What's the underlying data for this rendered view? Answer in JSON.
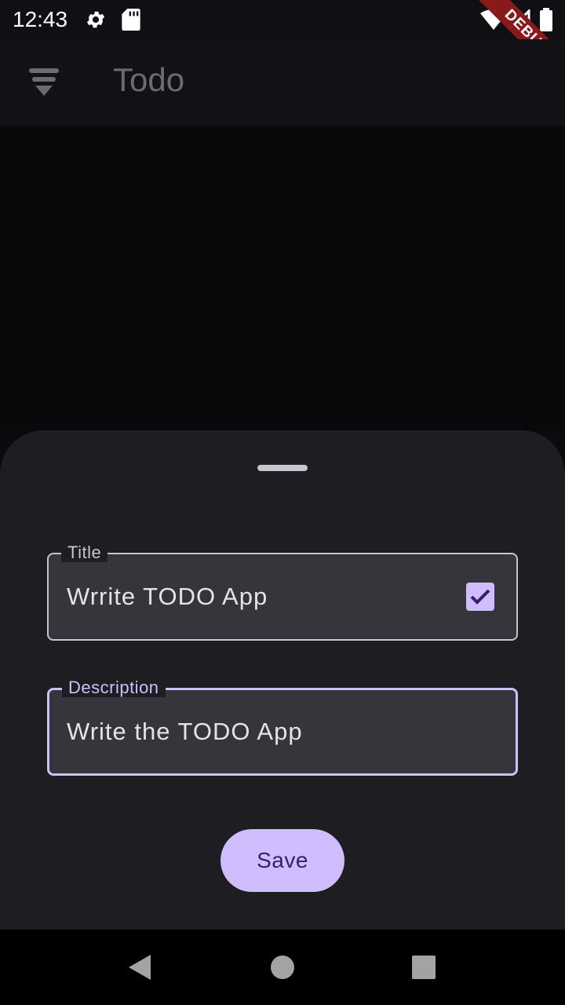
{
  "status_bar": {
    "time": "12:43",
    "left_icons": [
      "settings-icon",
      "sd-card-icon"
    ],
    "right_icons": [
      "wifi-icon",
      "signal-icon",
      "battery-icon"
    ]
  },
  "debug_banner": {
    "label": "DEBUG",
    "color": "#8a1a1a"
  },
  "app_bar": {
    "title": "Todo",
    "filter_icon": "filter-icon"
  },
  "sheet": {
    "title_field": {
      "label": "Title",
      "value": "Wrrite TODO App",
      "completed_checked": true
    },
    "description_field": {
      "label": "Description",
      "value": "Write the TODO App",
      "focused": true
    },
    "save_label": "Save"
  },
  "nav_bar": {
    "buttons": [
      "back-icon",
      "home-icon",
      "recents-icon"
    ]
  },
  "colors": {
    "accent": "#cfbdfe",
    "on_accent": "#371e73",
    "sheet_bg": "#1e1d22",
    "field_bg": "#36353b"
  }
}
